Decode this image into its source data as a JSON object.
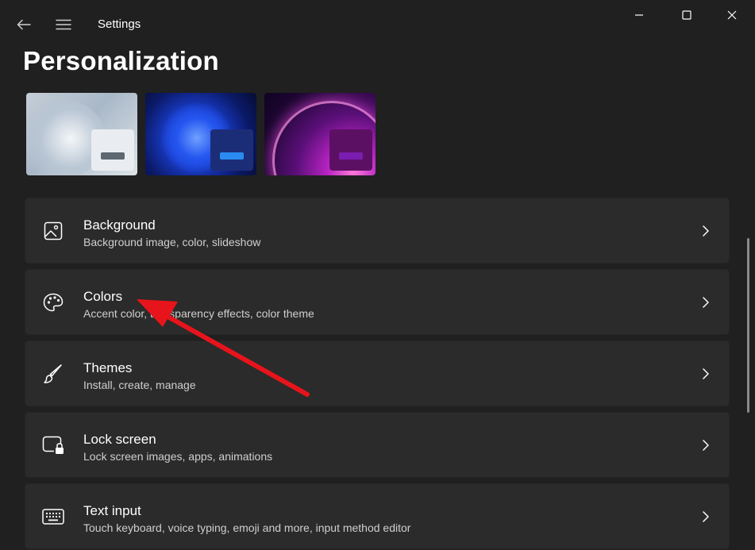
{
  "window": {
    "app_title": "Settings",
    "back_icon": "back-arrow-icon",
    "menu_icon": "hamburger-menu-icon",
    "minimize_icon": "minimize-icon",
    "maximize_icon": "maximize-icon",
    "close_icon": "close-icon"
  },
  "page": {
    "title": "Personalization"
  },
  "themes": [
    {
      "name": "light-bloom-theme",
      "preview_bar_color": "#5f6770"
    },
    {
      "name": "dark-blue-bloom-theme",
      "preview_bar_color": "#2a8cf0"
    },
    {
      "name": "purple-glow-theme",
      "preview_bar_color": "#7a1db0"
    }
  ],
  "settings": [
    {
      "title": "Background",
      "subtitle": "Background image, color, slideshow",
      "icon": "picture-icon"
    },
    {
      "title": "Colors",
      "subtitle": "Accent color, transparency effects, color theme",
      "icon": "palette-icon"
    },
    {
      "title": "Themes",
      "subtitle": "Install, create, manage",
      "icon": "brush-icon"
    },
    {
      "title": "Lock screen",
      "subtitle": "Lock screen images, apps, animations",
      "icon": "lock-screen-icon"
    },
    {
      "title": "Text input",
      "subtitle": "Touch keyboard, voice typing, emoji and more, input method editor",
      "icon": "keyboard-icon"
    }
  ],
  "colors": {
    "background": "#202020",
    "card": "#2b2b2b",
    "annotation_arrow": "#e8141b"
  }
}
